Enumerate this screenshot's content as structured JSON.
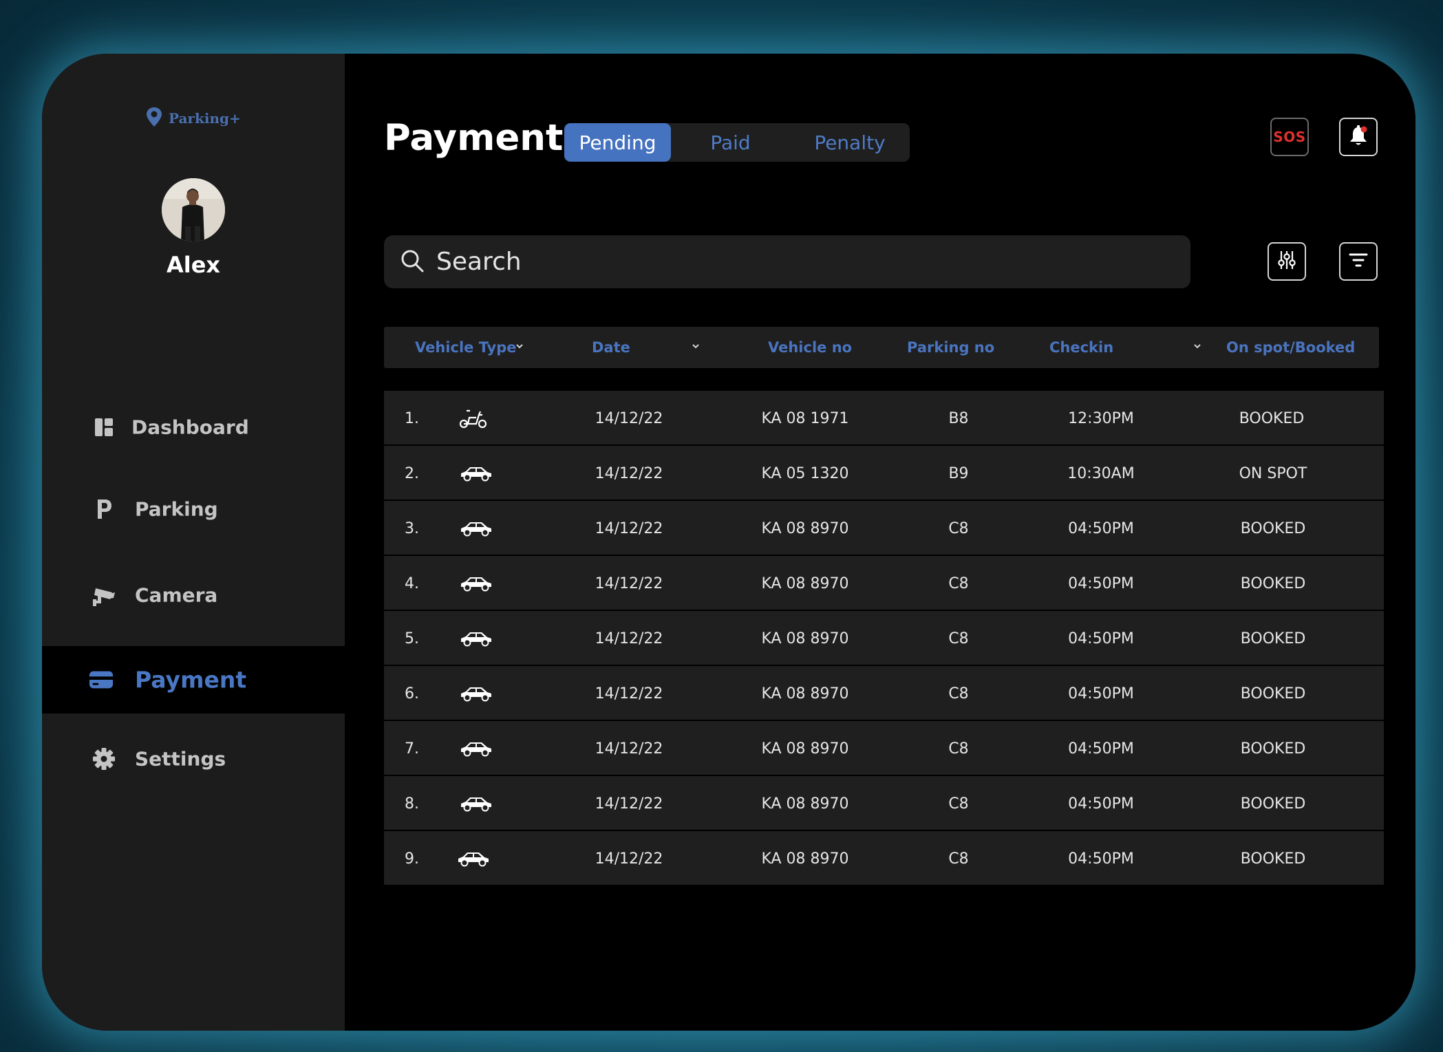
{
  "app": {
    "logo_text": "Parking+"
  },
  "user": {
    "name": "Alex"
  },
  "sidebar": {
    "items": [
      {
        "label": "Dashboard",
        "icon": "dashboard-icon",
        "active": false
      },
      {
        "label": "Parking",
        "icon": "parking-icon",
        "active": false
      },
      {
        "label": "Camera",
        "icon": "camera-icon",
        "active": false
      },
      {
        "label": "Payment",
        "icon": "credit-card-icon",
        "active": true
      },
      {
        "label": "Settings",
        "icon": "gear-icon",
        "active": false
      }
    ]
  },
  "page": {
    "title": "Payment"
  },
  "tabs": [
    {
      "label": "Pending",
      "active": true
    },
    {
      "label": "Paid",
      "active": false
    },
    {
      "label": "Penalty",
      "active": false
    }
  ],
  "header_actions": {
    "sos_label": "SOS",
    "notification_icon": "bell-icon"
  },
  "search": {
    "placeholder": "Search",
    "value": ""
  },
  "toolbar": {
    "adjust_icon": "sliders-icon",
    "filter_icon": "filter-icon"
  },
  "table": {
    "columns": [
      "Vehicle Type",
      "Date",
      "Vehicle no",
      "Parking no",
      "Checkin",
      "On spot/Booked"
    ],
    "rows": [
      {
        "index": "1.",
        "vehicle_icon": "scooter-icon",
        "date": "14/12/22",
        "vehicle_no": "KA 08 1971",
        "parking_no": "B8",
        "checkin": "12:30PM",
        "status": "BOOKED"
      },
      {
        "index": "2.",
        "vehicle_icon": "car-icon",
        "date": "14/12/22",
        "vehicle_no": "KA 05 1320",
        "parking_no": "B9",
        "checkin": "10:30AM",
        "status": "ON SPOT"
      },
      {
        "index": "3.",
        "vehicle_icon": "car-icon",
        "date": "14/12/22",
        "vehicle_no": "KA 08 8970",
        "parking_no": "C8",
        "checkin": "04:50PM",
        "status": "BOOKED"
      },
      {
        "index": "4.",
        "vehicle_icon": "car-icon",
        "date": "14/12/22",
        "vehicle_no": "KA 08 8970",
        "parking_no": "C8",
        "checkin": "04:50PM",
        "status": "BOOKED"
      },
      {
        "index": "5.",
        "vehicle_icon": "car-icon",
        "date": "14/12/22",
        "vehicle_no": "KA 08 8970",
        "parking_no": "C8",
        "checkin": "04:50PM",
        "status": "BOOKED"
      },
      {
        "index": "6.",
        "vehicle_icon": "car-icon",
        "date": "14/12/22",
        "vehicle_no": "KA 08 8970",
        "parking_no": "C8",
        "checkin": "04:50PM",
        "status": "BOOKED"
      },
      {
        "index": "7.",
        "vehicle_icon": "car-icon",
        "date": "14/12/22",
        "vehicle_no": "KA 08 8970",
        "parking_no": "C8",
        "checkin": "04:50PM",
        "status": "BOOKED"
      },
      {
        "index": "8.",
        "vehicle_icon": "car-icon",
        "date": "14/12/22",
        "vehicle_no": "KA 08 8970",
        "parking_no": "C8",
        "checkin": "04:50PM",
        "status": "BOOKED"
      },
      {
        "index": "9.",
        "vehicle_icon": "car-icon",
        "date": "14/12/22",
        "vehicle_no": "KA 08 8970",
        "parking_no": "C8",
        "checkin": "04:50PM",
        "status": "BOOKED"
      }
    ]
  },
  "colors": {
    "accent": "#4673C0",
    "sos_red": "#E0312E",
    "panel": "#1F1F1F",
    "sidebar": "#1C1C1C"
  }
}
